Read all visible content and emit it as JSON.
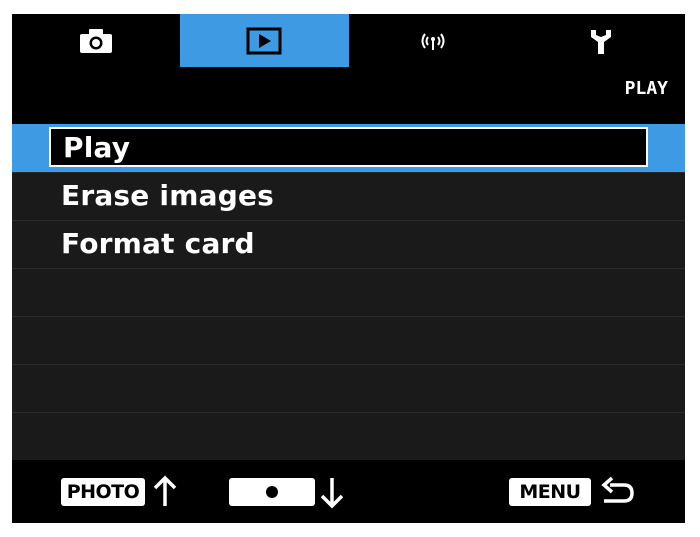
{
  "tabs": [
    {
      "icon": "camera-icon",
      "active": false
    },
    {
      "icon": "play-icon",
      "active": true
    },
    {
      "icon": "wireless-icon",
      "active": false
    },
    {
      "icon": "wrench-icon",
      "active": false
    }
  ],
  "header": {
    "title": "PLAY"
  },
  "menu": {
    "items": [
      {
        "label": "Play",
        "selected": true
      },
      {
        "label": "Erase images",
        "selected": false
      },
      {
        "label": "Format card",
        "selected": false
      },
      {
        "label": "",
        "selected": false
      },
      {
        "label": "",
        "selected": false
      },
      {
        "label": "",
        "selected": false
      },
      {
        "label": "",
        "selected": false
      }
    ]
  },
  "footer": {
    "photo_key": "PHOTO",
    "menu_key": "MENU",
    "photo_arrow": "up-arrow-icon",
    "record_arrow": "down-arrow-icon",
    "back_icon": "back-arrow-icon"
  },
  "colors": {
    "accent": "#3d9ae3",
    "background": "#000000",
    "row": "#1a1a1a",
    "text": "#ffffff"
  }
}
